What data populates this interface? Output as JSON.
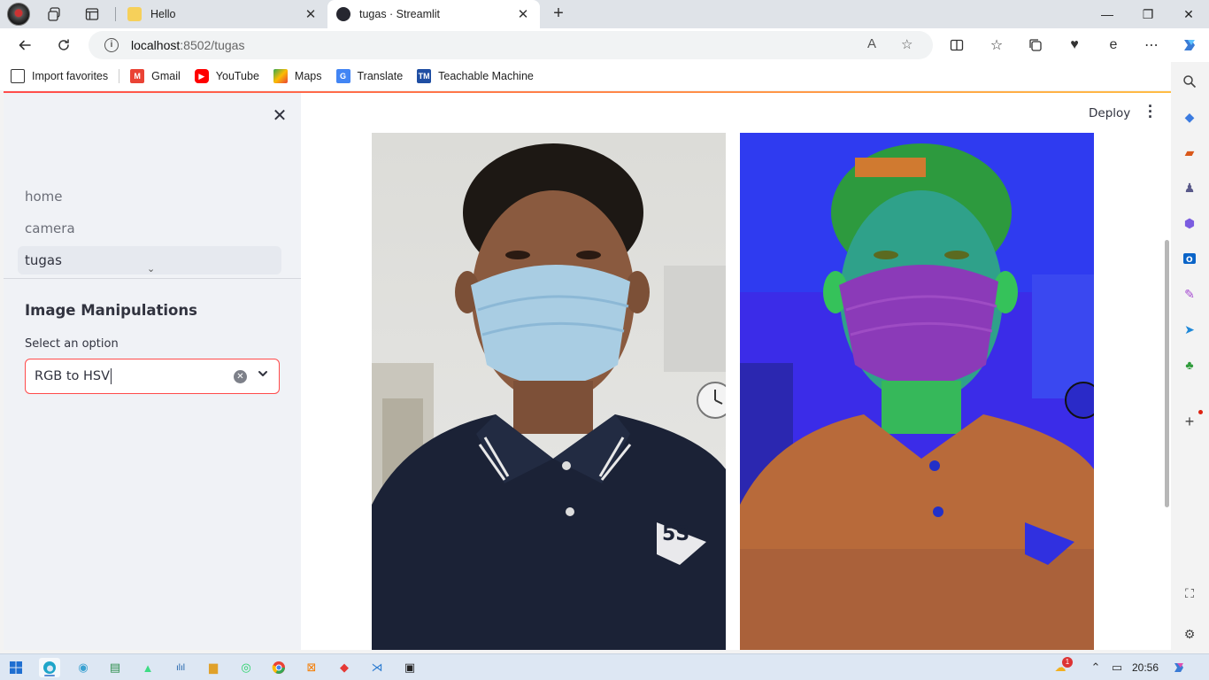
{
  "browser": {
    "tabs": [
      {
        "title": "Hello",
        "close": "✕"
      },
      {
        "title": "tugas · Streamlit",
        "close": "✕"
      }
    ],
    "new_tab": "+",
    "window_controls": {
      "minimize": "—",
      "maximize": "❐",
      "close": "✕"
    },
    "address": {
      "host": "localhost",
      "path": ":8502/tugas"
    },
    "favorites": [
      {
        "label": "Import favorites",
        "icon": "import-icon"
      },
      {
        "label": "Gmail",
        "icon": "gmail-icon"
      },
      {
        "label": "YouTube",
        "icon": "youtube-icon"
      },
      {
        "label": "Maps",
        "icon": "maps-icon"
      },
      {
        "label": "Translate",
        "icon": "translate-icon"
      },
      {
        "label": "Teachable Machine",
        "icon": "teachable-machine-icon"
      }
    ]
  },
  "app": {
    "nav": [
      {
        "label": "home"
      },
      {
        "label": "camera"
      },
      {
        "label": "tugas"
      }
    ],
    "sidebar_heading": "Image Manipulations",
    "select_label": "Select an option",
    "select_value": "RGB to HSV",
    "deploy_label": "Deploy",
    "accent_color": "#ff4b4b"
  },
  "taskbar": {
    "time": "20:56",
    "notification_count": "1"
  }
}
